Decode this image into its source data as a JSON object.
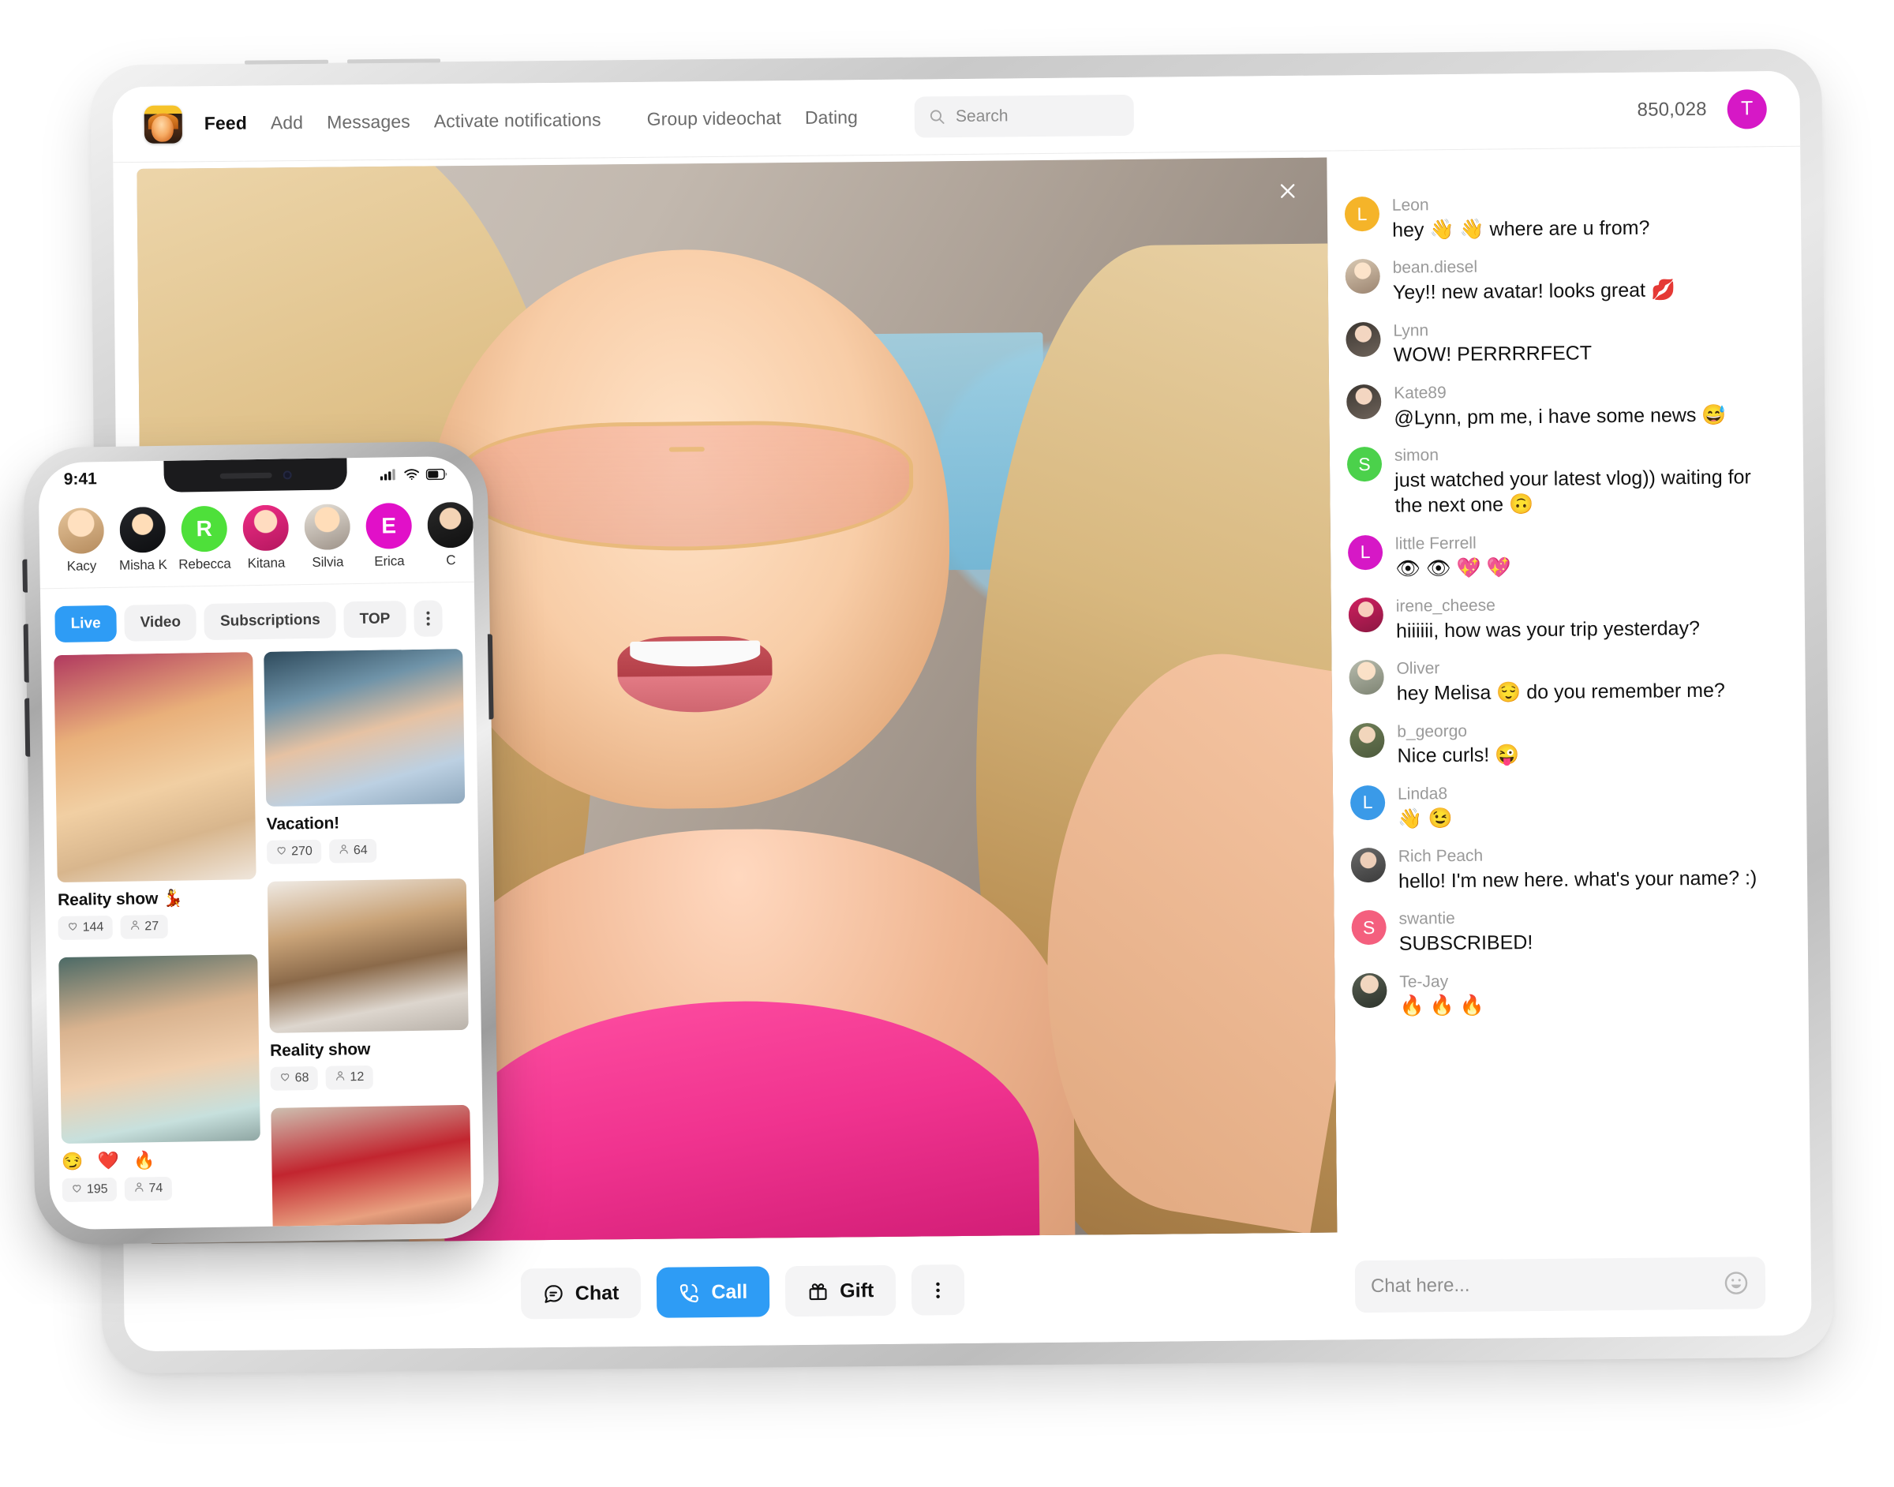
{
  "tablet": {
    "nav": {
      "brand_icon": "app-logo",
      "links": [
        {
          "label": "Feed",
          "active": true
        },
        {
          "label": "Add",
          "active": false
        },
        {
          "label": "Messages",
          "active": false
        },
        {
          "label": "Activate notifications",
          "active": false
        },
        {
          "label": "Group videochat",
          "active": false
        },
        {
          "label": "Dating",
          "active": false
        }
      ],
      "search": {
        "placeholder": "Search",
        "value": "",
        "icon": "search-icon"
      },
      "counter": "850,028",
      "avatar_initial": "T",
      "avatar_color": "#d618c6"
    },
    "video": {
      "close_icon": "close-icon"
    },
    "actions": [
      {
        "label": "Chat",
        "icon": "chat-bubble-icon",
        "primary": false
      },
      {
        "label": "Call",
        "icon": "phone-call-icon",
        "primary": true
      },
      {
        "label": "Gift",
        "icon": "gift-icon",
        "primary": false
      },
      {
        "label": "",
        "icon": "more-vertical-icon",
        "primary": false
      }
    ],
    "chat": {
      "messages": [
        {
          "name": "Leon",
          "text": "hey 👋 👋  where are u from?",
          "avatar_type": "initial",
          "initial": "L",
          "color": "#f5b429"
        },
        {
          "name": "bean.diesel",
          "text": "Yey!! new avatar! looks great 💋",
          "avatar_type": "photo",
          "photo_class": "p2"
        },
        {
          "name": "Lynn",
          "text": "WOW! PERRRRFECT",
          "avatar_type": "photo",
          "photo_class": "p3"
        },
        {
          "name": "Kate89",
          "text": "@Lynn, pm me, i have some news 😅",
          "avatar_type": "photo",
          "photo_class": "p3"
        },
        {
          "name": "simon",
          "text": "just watched your latest vlog)) waiting for the next one 🙃",
          "avatar_type": "initial",
          "initial": "S",
          "color": "#4bd14b"
        },
        {
          "name": "little Ferrell",
          "text": "👁 👁 💖 💖",
          "avatar_type": "initial",
          "initial": "L",
          "color": "#d618c6"
        },
        {
          "name": "irene_cheese",
          "text": "hiiiiii, how was your trip yesterday?",
          "avatar_type": "photo",
          "photo_class": "p4"
        },
        {
          "name": "Oliver",
          "text": "hey Melisa 😌  do you remember me?",
          "avatar_type": "photo",
          "photo_class": "p5"
        },
        {
          "name": "b_georgo",
          "text": "Nice curls! 😜",
          "avatar_type": "photo",
          "photo_class": "p6"
        },
        {
          "name": "Linda8",
          "text": "👋 😉",
          "avatar_type": "initial",
          "initial": "L",
          "color": "#3a9ae8"
        },
        {
          "name": "Rich Peach",
          "text": "hello! I'm new here. what's your name? :)",
          "avatar_type": "photo",
          "photo_class": "p7"
        },
        {
          "name": "swantie",
          "text": "SUBSCRIBED!",
          "avatar_type": "initial",
          "initial": "S",
          "color": "#f45f7e"
        },
        {
          "name": "Te-Jay",
          "text": "🔥 🔥 🔥",
          "avatar_type": "photo",
          "photo_class": "p8"
        }
      ],
      "input": {
        "placeholder": "Chat here...",
        "value": "",
        "emoji_icon": "emoji-smiley-icon"
      }
    }
  },
  "phone": {
    "status": {
      "time": "9:41",
      "icons": [
        "cellular-signal-icon",
        "wifi-icon",
        "battery-icon"
      ]
    },
    "stories": [
      {
        "name": "Kacy",
        "type": "photo",
        "photo_class": "a1"
      },
      {
        "name": "Misha K",
        "type": "photo",
        "photo_class": "a2"
      },
      {
        "name": "Rebecca",
        "type": "initial",
        "initial": "R",
        "color": "#4ee03a"
      },
      {
        "name": "Kitana",
        "type": "photo",
        "photo_class": "a4"
      },
      {
        "name": "Silvia",
        "type": "photo",
        "photo_class": "a5"
      },
      {
        "name": "Erica",
        "type": "initial",
        "initial": "E",
        "color": "#e110c8"
      },
      {
        "name": "C",
        "type": "photo",
        "photo_class": "a7"
      }
    ],
    "filters": [
      {
        "label": "Live",
        "active": true
      },
      {
        "label": "Video",
        "active": false
      },
      {
        "label": "Subscriptions",
        "active": false
      },
      {
        "label": "TOP",
        "active": false
      },
      {
        "label": "",
        "active": false,
        "icon": "more-vertical-icon"
      }
    ],
    "feed": {
      "left": [
        {
          "title": "Reality show 💃",
          "emojis": "",
          "likes": "144",
          "viewers": "27",
          "img_class": "i1"
        },
        {
          "title": "",
          "emojis": "😏 ❤️ 🔥",
          "likes": "195",
          "viewers": "74",
          "img_class": "i4"
        }
      ],
      "right": [
        {
          "title": "Vacation!",
          "emojis": "",
          "likes": "270",
          "viewers": "64",
          "img_class": "i2"
        },
        {
          "title": "Reality show",
          "emojis": "",
          "likes": "68",
          "viewers": "12",
          "img_class": "i3"
        },
        {
          "title": "",
          "emojis": "",
          "likes": "",
          "viewers": "",
          "img_class": "i5"
        }
      ]
    }
  }
}
